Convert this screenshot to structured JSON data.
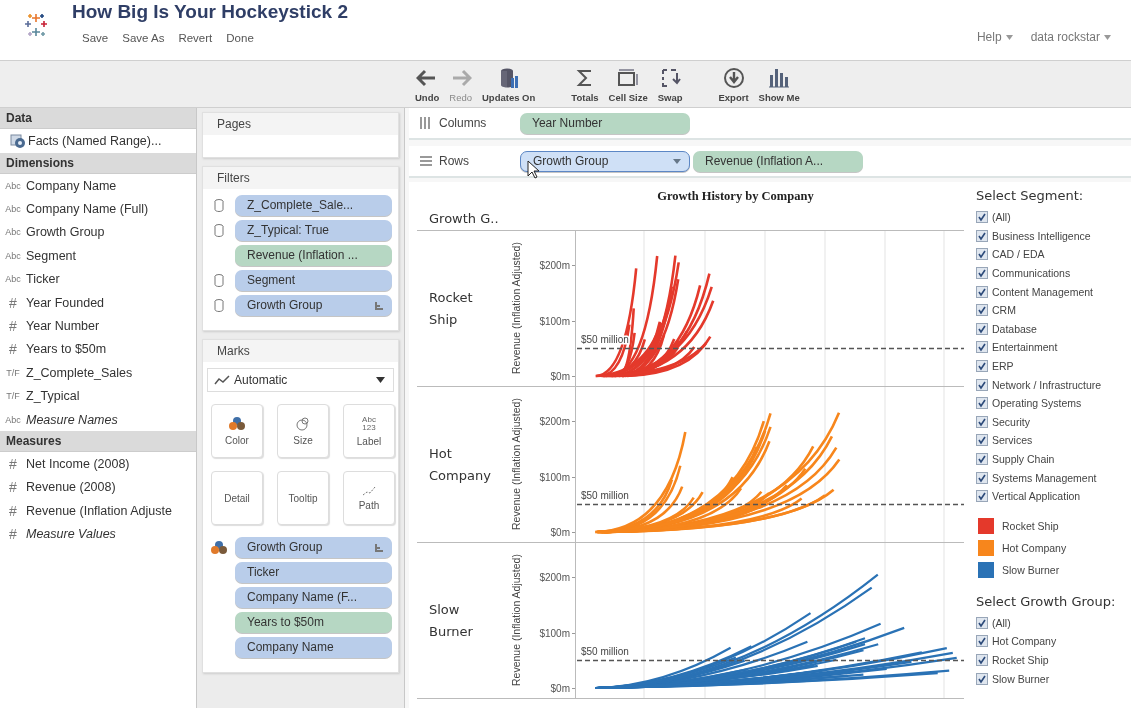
{
  "app": {
    "title": "How Big Is Your Hockeystick 2",
    "menu": [
      "Save",
      "Save As",
      "Revert",
      "Done"
    ],
    "top_links": [
      "Help",
      "data rockstar"
    ]
  },
  "toolbar": [
    {
      "items": [
        {
          "label": "Undo",
          "kind": "undo",
          "disabled": false
        },
        {
          "label": "Redo",
          "kind": "redo",
          "disabled": true
        },
        {
          "label": "Updates On",
          "kind": "updates",
          "disabled": false
        }
      ]
    },
    {
      "items": [
        {
          "label": "Totals",
          "kind": "totals",
          "disabled": false
        },
        {
          "label": "Cell Size",
          "kind": "cell-size",
          "disabled": false
        },
        {
          "label": "Swap",
          "kind": "swap",
          "disabled": false
        }
      ]
    },
    {
      "items": [
        {
          "label": "Export",
          "kind": "export",
          "disabled": false
        },
        {
          "label": "Show Me",
          "kind": "show-me",
          "disabled": false
        }
      ]
    }
  ],
  "data_pane": {
    "title": "Data",
    "source": "Facts (Named Range)...",
    "sections": [
      {
        "title": "Dimensions",
        "fields": [
          {
            "type": "Abc",
            "name": "Company Name",
            "italic": false
          },
          {
            "type": "Abc",
            "name": "Company Name (Full)",
            "italic": false
          },
          {
            "type": "Abc",
            "name": "Growth Group",
            "italic": false
          },
          {
            "type": "Abc",
            "name": "Segment",
            "italic": false
          },
          {
            "type": "Abc",
            "name": "Ticker",
            "italic": false
          },
          {
            "type": "#",
            "name": "Year Founded",
            "italic": false
          },
          {
            "type": "#",
            "name": "Year Number",
            "italic": false
          },
          {
            "type": "#",
            "name": "Years to $50m",
            "italic": false
          },
          {
            "type": "T/F",
            "name": "Z_Complete_Sales",
            "italic": false
          },
          {
            "type": "T/F",
            "name": "Z_Typical",
            "italic": false
          },
          {
            "type": "Abc",
            "name": "Measure Names",
            "italic": true
          }
        ]
      },
      {
        "title": "Measures",
        "fields": [
          {
            "type": "#",
            "name": "Net Income (2008)",
            "italic": false
          },
          {
            "type": "#",
            "name": "Revenue (2008)",
            "italic": false
          },
          {
            "type": "#",
            "name": "Revenue (Inflation Adjuste",
            "italic": false
          },
          {
            "type": "#",
            "name": "Measure Values",
            "italic": true
          }
        ]
      }
    ]
  },
  "pages": {
    "title": "Pages"
  },
  "filters": {
    "title": "Filters",
    "pills": [
      {
        "label": "Z_Complete_Sale...",
        "kind": "dimension",
        "db": true,
        "sorted": false
      },
      {
        "label": "Z_Typical: True",
        "kind": "dimension",
        "db": true,
        "sorted": false
      },
      {
        "label": "Revenue (Inflation ...",
        "kind": "measure",
        "db": false,
        "sorted": false
      },
      {
        "label": "Segment",
        "kind": "dimension",
        "db": true,
        "sorted": false
      },
      {
        "label": "Growth Group",
        "kind": "dimension",
        "db": true,
        "sorted": true
      }
    ]
  },
  "marks": {
    "title": "Marks",
    "mark_type": "Automatic",
    "buttons": [
      {
        "label": "Color",
        "kind": "color"
      },
      {
        "label": "Size",
        "kind": "size"
      },
      {
        "label": "Label",
        "kind": "label",
        "glyph": "Abc 123"
      },
      {
        "label": "Detail",
        "kind": "detail"
      },
      {
        "label": "Tooltip",
        "kind": "tooltip"
      },
      {
        "label": "Path",
        "kind": "path"
      }
    ],
    "pills": [
      {
        "label": "Growth Group",
        "kind": "dimension",
        "on_color": true,
        "sorted": true
      },
      {
        "label": "Ticker",
        "kind": "dimension",
        "on_color": false,
        "sorted": false
      },
      {
        "label": "Company Name (F...",
        "kind": "dimension",
        "on_color": false,
        "sorted": false
      },
      {
        "label": "Years to $50m",
        "kind": "measure",
        "on_color": false,
        "sorted": false
      },
      {
        "label": "Company Name",
        "kind": "dimension",
        "on_color": false,
        "sorted": false
      }
    ]
  },
  "shelves": [
    {
      "label": "Columns",
      "kind": "columns",
      "pills": [
        {
          "label": "Year Number",
          "kind": "measure",
          "highlighted": false
        }
      ]
    },
    {
      "label": "Rows",
      "kind": "rows",
      "pills": [
        {
          "label": "Growth Group",
          "kind": "dimension",
          "highlighted": true
        },
        {
          "label": "Revenue (Inflation A...",
          "kind": "measure",
          "highlighted": false
        }
      ]
    }
  ],
  "view": {
    "title": "Growth History by Company",
    "row_header": "Growth G..",
    "panels": [
      {
        "label": "Rocket Ship",
        "kind": "rocket",
        "color": "#e4392b",
        "axis_title": "Revenue (Inflation Adjusted)",
        "ticks": [
          "$200m",
          "$100m",
          "$0m"
        ],
        "reference_label": "$50 million"
      },
      {
        "label": "Hot Company",
        "kind": "hot",
        "color": "#f7861c",
        "axis_title": "Revenue (Inflation Adjusted)",
        "ticks": [
          "$200m",
          "$100m",
          "$0m"
        ],
        "reference_label": "$50 million"
      },
      {
        "label": "Slow Burner",
        "kind": "slow",
        "color": "#2a72b5",
        "axis_title": "Revenue (Inflation Adjusted)",
        "ticks": [
          "$200m",
          "$100m",
          "$0m"
        ],
        "reference_label": "$50 million"
      }
    ]
  },
  "legend": {
    "segment_filter": {
      "title": "Select Segment:",
      "items": [
        {
          "label": "(All)",
          "checked": true
        },
        {
          "label": "Business Intelligence",
          "checked": true
        },
        {
          "label": "CAD / EDA",
          "checked": true
        },
        {
          "label": "Communications",
          "checked": true
        },
        {
          "label": "Content Management",
          "checked": true
        },
        {
          "label": "CRM",
          "checked": true
        },
        {
          "label": "Database",
          "checked": true
        },
        {
          "label": "Entertainment",
          "checked": true
        },
        {
          "label": "ERP",
          "checked": true
        },
        {
          "label": "Network / Infrastructure",
          "checked": true
        },
        {
          "label": "Operating Systems",
          "checked": true
        },
        {
          "label": "Security",
          "checked": true
        },
        {
          "label": "Services",
          "checked": true
        },
        {
          "label": "Supply Chain",
          "checked": true
        },
        {
          "label": "Systems Management",
          "checked": true
        },
        {
          "label": "Vertical Application",
          "checked": true
        }
      ]
    },
    "color_legend": [
      {
        "label": "Rocket Ship",
        "color": "#e4392b"
      },
      {
        "label": "Hot Company",
        "color": "#f7861c"
      },
      {
        "label": "Slow Burner",
        "color": "#2a72b5"
      }
    ],
    "growth_filter": {
      "title": "Select Growth Group:",
      "items": [
        {
          "label": "(All)",
          "checked": true
        },
        {
          "label": "Hot Company",
          "checked": true
        },
        {
          "label": "Rocket Ship",
          "checked": true
        },
        {
          "label": "Slow Burner",
          "checked": true
        }
      ]
    }
  }
}
